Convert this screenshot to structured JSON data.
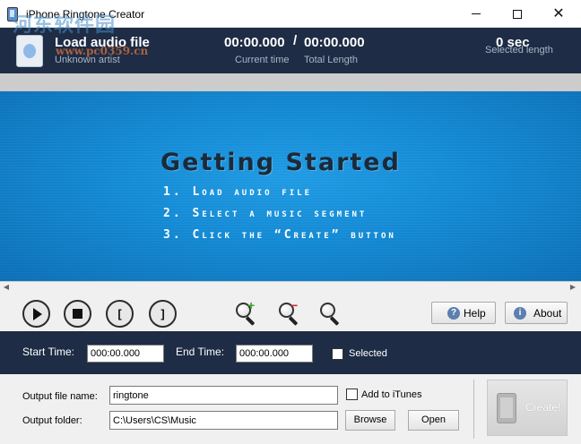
{
  "window": {
    "title": "iPhone Ringtone Creator",
    "minimize": "—",
    "maximize": "□",
    "close": "✕"
  },
  "watermark": {
    "text": "河东软件园",
    "url": "www.pc0359.cn"
  },
  "info": {
    "file_name": "Load audio file",
    "artist": "Unknown artist",
    "current_time": "00:00.000",
    "separator": "/",
    "total_length": "00:00.000",
    "current_time_label": "Current time",
    "total_length_label": "Total Length",
    "selected_length": "0 sec",
    "selected_length_label": "Selected length"
  },
  "getting_started": {
    "title": "Getting Started",
    "steps": [
      "1. Load audio file",
      "2. Select a music segment",
      "3. Click the “Create” button"
    ]
  },
  "scrollbar": {
    "left_arrow": "◀",
    "right_arrow": "▶"
  },
  "toolbar": {
    "mark_in": "[",
    "mark_out": "]",
    "zoom_in_badge": "+",
    "zoom_out_badge": "−",
    "help_icon": "?",
    "help_label": "Help",
    "about_icon": "i",
    "about_label": "About"
  },
  "time_range": {
    "start_label": "Start Time:",
    "start_value": "000:00.000",
    "end_label": "End Time:",
    "end_value": "000:00.000",
    "selected_label": "Selected"
  },
  "output": {
    "file_name_label": "Output file name:",
    "file_name_value": "ringtone",
    "add_itunes_label": "Add to iTunes",
    "folder_label": "Output folder:",
    "folder_value": "C:\\Users\\CS\\Music",
    "browse_label": "Browse",
    "open_label": "Open",
    "create_label": "Create!"
  }
}
